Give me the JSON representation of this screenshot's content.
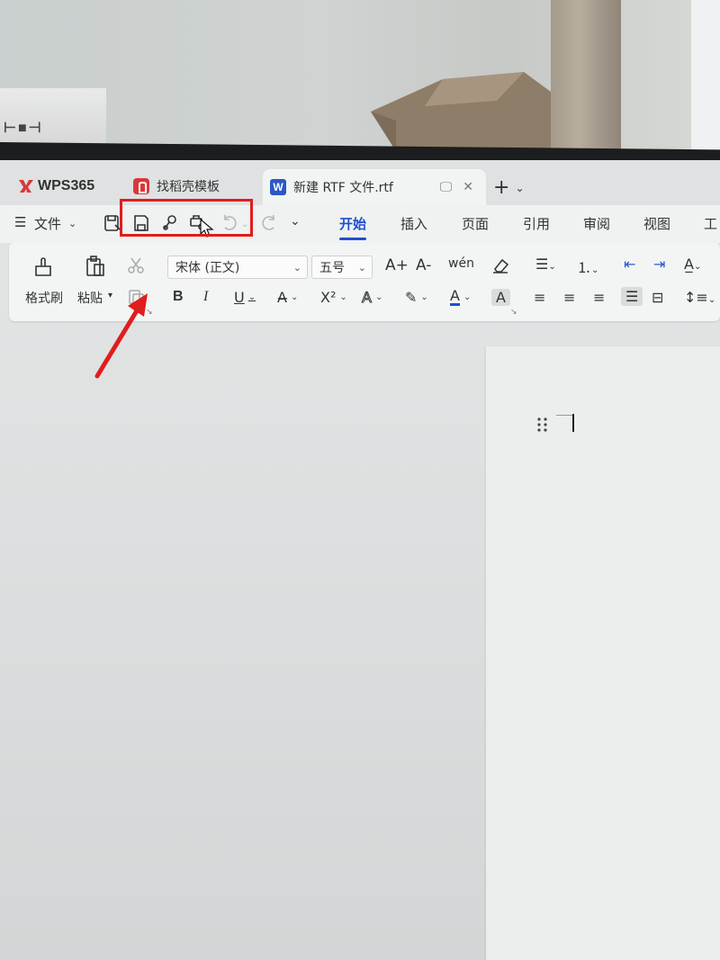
{
  "tabs": {
    "app_label": "WPS365",
    "template_label": "找稻壳模板",
    "document_label": "新建 RTF 文件.rtf",
    "document_icon_letter": "W"
  },
  "menu": {
    "file_label": "文件",
    "items": [
      "开始",
      "插入",
      "页面",
      "引用",
      "审阅",
      "视图",
      "工"
    ],
    "active_index": 0
  },
  "ribbon": {
    "format_painter_label": "格式刷",
    "paste_label": "粘贴",
    "font_name": "宋体 (正文)",
    "font_size": "五号",
    "bold": "B",
    "italic": "I",
    "underline": "U",
    "superscript": "X²",
    "font_color_letter": "A",
    "shade_letter": "A",
    "grow": "A+",
    "shrink": "A-",
    "pinyin": "wén",
    "text_effect": "A"
  },
  "colors": {
    "accent": "#1f4fd0",
    "highlight_box": "#e11d1d",
    "annotation_arrow": "#e11d1d",
    "wps_logo": "#d8383c",
    "doc_badge": "#2b57c9"
  },
  "icons": {
    "quick_access": [
      "save-as-icon",
      "save-icon",
      "link-icon",
      "print-preview-icon",
      "undo-icon",
      "redo-icon",
      "more-chevron-icon"
    ]
  }
}
